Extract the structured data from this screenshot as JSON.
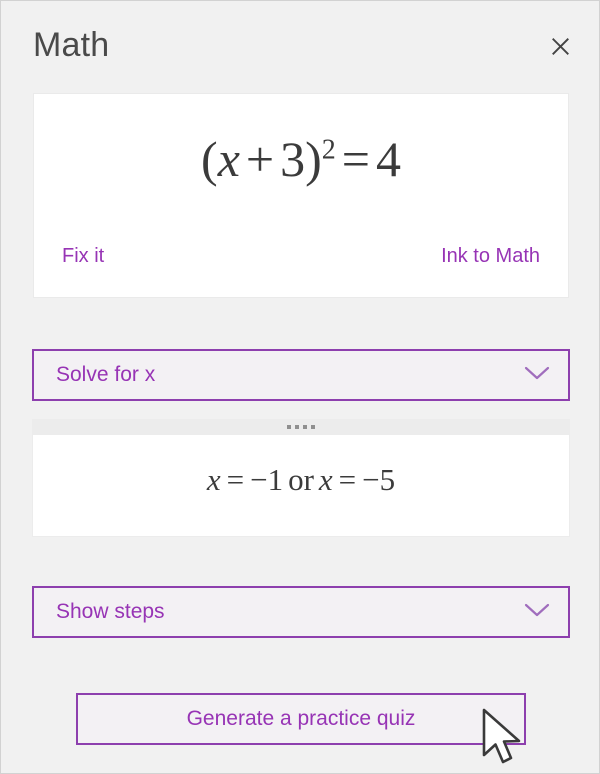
{
  "pane": {
    "title": "Math",
    "close_icon": "close-icon",
    "accent_color": "#9734b5",
    "border_color": "#8d3fae",
    "background_color": "#f1f1f1"
  },
  "equation_card": {
    "equation_text": "(x + 3)^2 = 4",
    "equation": {
      "open_paren": "(",
      "variable": "x",
      "plus": "+",
      "constant": "3",
      "close_paren": ")",
      "exponent": "2",
      "equals": "=",
      "right_side": "4"
    },
    "actions": {
      "fix_it_label": "Fix it",
      "ink_to_math_label": "Ink to Math"
    }
  },
  "solve_dropdown": {
    "label": "Solve for x",
    "icon": "chevron-down-icon",
    "expanded": true
  },
  "result": {
    "handle_icon": "drag-handle-dots",
    "solution_text": "x = −1 or x = −5",
    "solution": {
      "var1": "x",
      "eq1": "=",
      "value1": "−1",
      "conjunction": "or",
      "var2": "x",
      "eq2": "=",
      "value2": "−5"
    }
  },
  "steps_dropdown": {
    "label": "Show steps",
    "icon": "chevron-down-icon",
    "expanded": false
  },
  "quiz_button": {
    "label": "Generate a practice quiz"
  },
  "cursor": {
    "icon": "mouse-pointer-arrow"
  }
}
